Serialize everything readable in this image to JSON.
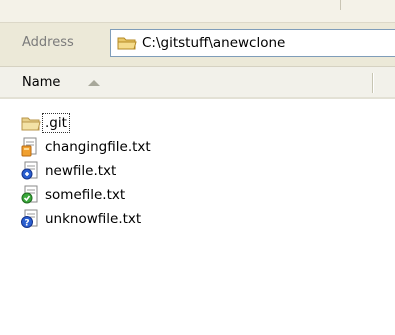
{
  "address": {
    "label": "Address",
    "path": "C:\\gitstuff\\anewclone"
  },
  "columns": {
    "name_label": "Name",
    "sort": "ascending"
  },
  "files": [
    {
      "name": ".git",
      "icon": "folder-icon",
      "focused": true
    },
    {
      "name": "changingfile.txt",
      "icon": "modified-file-icon",
      "overlay_color": "#f0a030"
    },
    {
      "name": "newfile.txt",
      "icon": "added-file-icon",
      "overlay_color": "#2a5fd0"
    },
    {
      "name": "somefile.txt",
      "icon": "normal-file-icon",
      "overlay_color": "#3aa83a"
    },
    {
      "name": "unknowfile.txt",
      "icon": "unversioned-file-icon",
      "overlay_color": "#2a5fd0"
    }
  ]
}
